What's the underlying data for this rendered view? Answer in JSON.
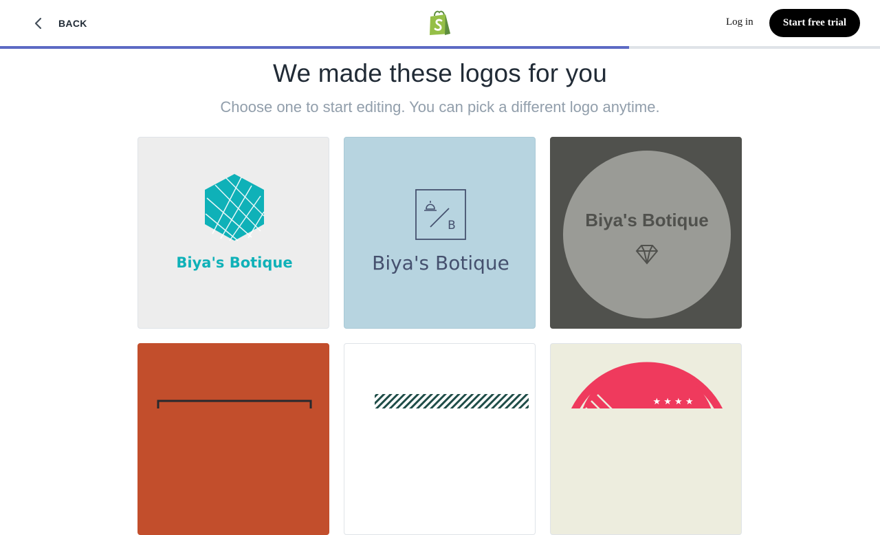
{
  "header": {
    "back_label": "BACK",
    "brand_icon": "shopify-bag-icon",
    "login_label": "Log in",
    "cta_label": "Start free trial",
    "progress_fraction": 0.715
  },
  "main": {
    "title": "We made these logos for you",
    "subtitle": "Choose one to start editing. You can pick a different logo anytime."
  },
  "logos": [
    {
      "name": "Biya's Botique",
      "style": "teal-hexagon",
      "background": "#ededed",
      "accent": "#0fb1b8"
    },
    {
      "name": "Biya's Botique",
      "style": "framed-monogram",
      "monogram": "B",
      "background": "#b7d4e0",
      "accent": "#45506e"
    },
    {
      "name": "Biya's Botique",
      "style": "grey-circle-diamond",
      "background": "#50514d",
      "accent": "#9a9b96"
    },
    {
      "style": "rectangle-frame",
      "background": "#c24e2c"
    },
    {
      "style": "hatched-band",
      "background": "#ffffff",
      "accent": "#1f4d48"
    },
    {
      "style": "red-badge-stars",
      "stars": "★ ★ ★ ★",
      "background": "#ededde",
      "accent": "#ef3a5d"
    }
  ],
  "colors": {
    "progress": "#5c6ac4",
    "shopify_green": "#95bf47",
    "cta_bg": "#000000"
  }
}
